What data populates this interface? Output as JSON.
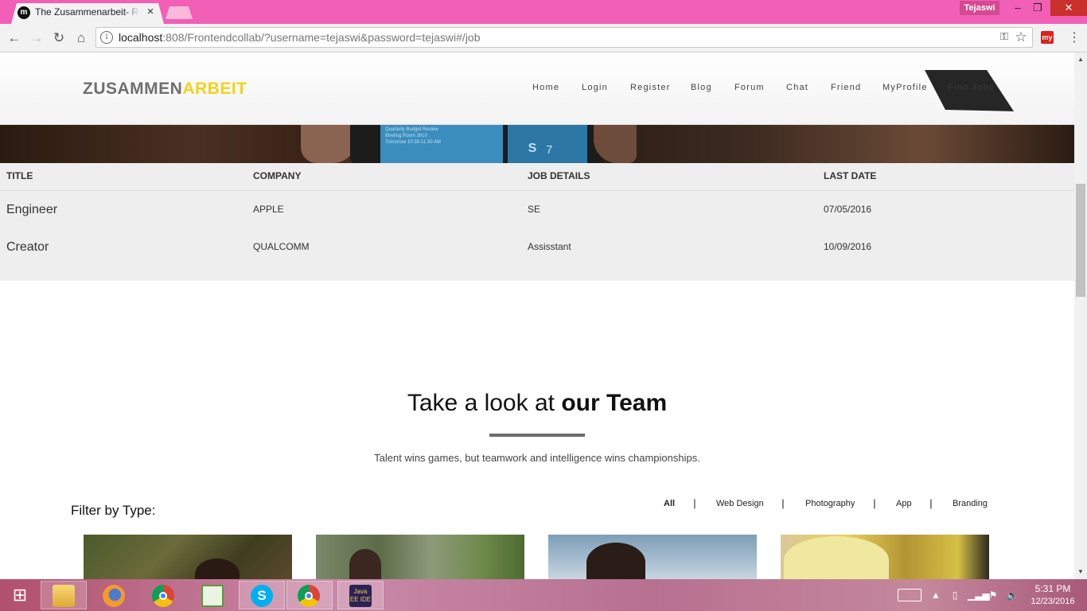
{
  "browser": {
    "tab_title": "The Zusammenarbeit- Re",
    "tab_close": "×",
    "favicon": "m",
    "user_badge": "Tejaswi",
    "window": {
      "minimize": "–",
      "maximize": "❐",
      "close": "✕"
    },
    "url_host": "localhost",
    "url_rest": ":808/Frontendcollab/?username=tejaswi&password=tejaswi#/job",
    "extension_label": "my",
    "icons": {
      "back": "arrow-left-icon",
      "forward": "arrow-right-icon",
      "reload": "reload-icon",
      "home": "home-icon",
      "info": "info-icon",
      "key": "key-icon",
      "star": "star-icon",
      "menu": "kebab-menu-icon"
    }
  },
  "site": {
    "logo_part1": "ZUSAMMEN",
    "logo_part2": "ARBEIT",
    "colors": {
      "logo_gray": "#6f6f6f",
      "logo_yellow": "#f3d21b",
      "active_nav_bg": "#262626"
    },
    "nav": [
      "Home",
      "Login",
      "Register",
      "Blog",
      "Forum",
      "Chat",
      "Friend",
      "MyProfile",
      "Find Jobs"
    ],
    "active_nav": "Find Jobs"
  },
  "hero": {
    "screen_text": "Quarterly Budget Review\nBriefing Room 3910\nTomorrow 10:30-11:30 AM",
    "skype_icon": "S",
    "count": "7"
  },
  "jobs": {
    "headers": [
      "TITLE",
      "COMPANY",
      "JOB DETAILS",
      "LAST DATE"
    ],
    "rows": [
      {
        "title": "Engineer",
        "company": "APPLE",
        "details": "SE",
        "last_date": "07/05/2016"
      },
      {
        "title": "Creator",
        "company": "QUALCOMM",
        "details": "Assisstant",
        "last_date": "10/09/2016"
      }
    ]
  },
  "team": {
    "heading_light": "Take a look at ",
    "heading_bold": "our Team",
    "tagline": "Talent wins games, but teamwork and intelligence wins championships.",
    "filter_label": "Filter by Type:",
    "filters": [
      "All",
      "Web Design",
      "Photography",
      "App",
      "Branding"
    ],
    "filter_separator": "|",
    "active_filter": "All"
  },
  "taskbar": {
    "apps": [
      "file-explorer",
      "firefox",
      "chrome",
      "notepad-plus-plus",
      "skype",
      "chrome",
      "eclipse-java-ee"
    ],
    "eclipse_label": "Java EE IDE",
    "skype_label": "S",
    "start_icon": "⊞",
    "tray": {
      "up": "▲",
      "power": "▯",
      "signal": "▁▃▅",
      "flag": "⚑",
      "volume": "🔈"
    },
    "time": "5:31 PM",
    "date": "12/23/2016"
  }
}
